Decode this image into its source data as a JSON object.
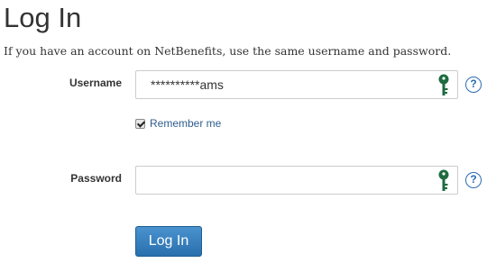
{
  "page": {
    "title": "Log In",
    "subtitle": "If you have an account on NetBenefits, use the same username and password."
  },
  "username": {
    "label": "Username",
    "value": "**********ams",
    "help_glyph": "?"
  },
  "remember": {
    "label": "Remember me",
    "checked": true
  },
  "password": {
    "label": "Password",
    "value": "",
    "help_glyph": "?"
  },
  "login_button": {
    "label": "Log In"
  },
  "icons": {
    "field_icon": "key-icon",
    "help_icon": "question-circle-icon"
  },
  "colors": {
    "key_green": "#1e6b3f",
    "help_blue": "#2b6cb0",
    "link_blue": "#2f5e8e",
    "button_blue": "#2f7ab8"
  }
}
